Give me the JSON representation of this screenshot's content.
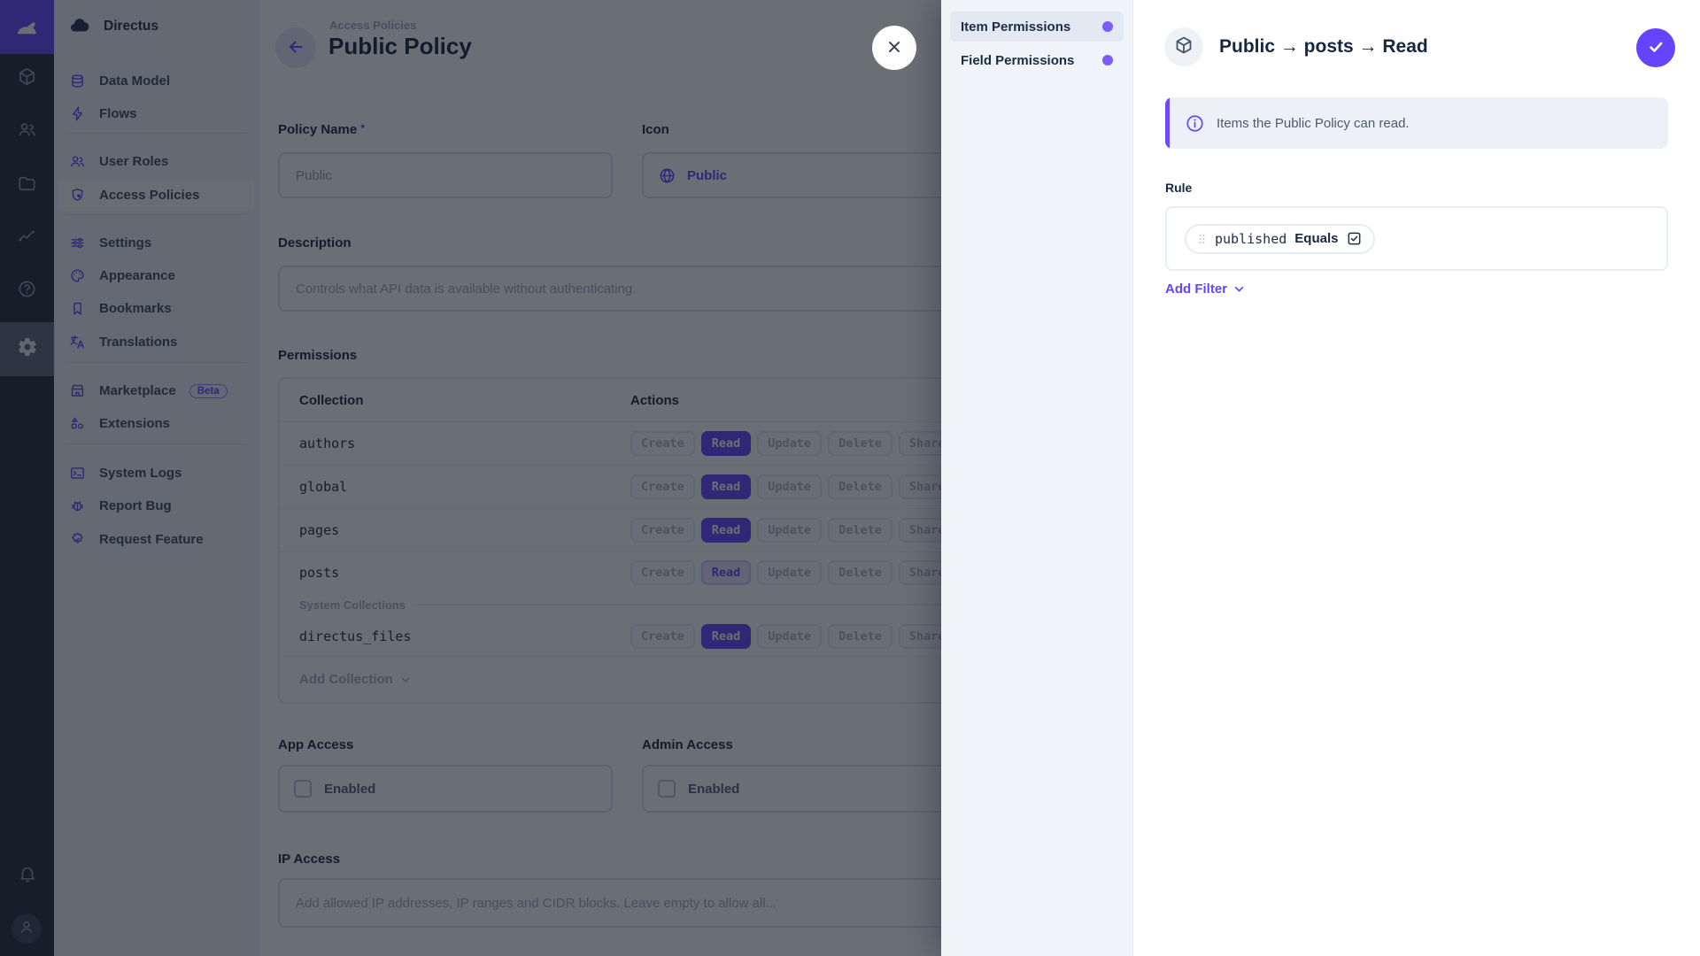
{
  "colors": {
    "purple": "#6644ff",
    "dot_purple": "#7b5cfb",
    "navy": "#172940"
  },
  "icons": {
    "module_bar": [
      "directus-rabbit",
      "box",
      "people",
      "folder",
      "insights",
      "help",
      "gear",
      "bell",
      "person"
    ],
    "nav": [
      "database",
      "bolt",
      "user-roles",
      "shield-lock",
      "sliders",
      "palette",
      "bookmark",
      "translate",
      "storefront",
      "shapes",
      "terminal",
      "bug",
      "badge-check"
    ],
    "misc": [
      "arrow-left",
      "globe",
      "chevron-down",
      "close-x",
      "cube",
      "check",
      "info-circle",
      "drag-handle",
      "checkbox-checked"
    ]
  },
  "nav": {
    "project_name": "Directus",
    "items": [
      {
        "label": "Data Model"
      },
      {
        "label": "Flows"
      },
      {
        "label": "User Roles"
      },
      {
        "label": "Access Policies"
      },
      {
        "label": "Settings"
      },
      {
        "label": "Appearance"
      },
      {
        "label": "Bookmarks"
      },
      {
        "label": "Translations"
      },
      {
        "label": "Marketplace",
        "badge": "Beta"
      },
      {
        "label": "Extensions"
      },
      {
        "label": "System Logs"
      },
      {
        "label": "Report Bug"
      },
      {
        "label": "Request Feature"
      }
    ]
  },
  "main": {
    "breadcrumb": "Access Policies",
    "title": "Public Policy",
    "policy_name": {
      "label": "Policy Name",
      "required_mark": "*",
      "value": "Public"
    },
    "icon_field": {
      "label": "Icon",
      "value": "Public"
    },
    "description": {
      "label": "Description",
      "placeholder": "Controls what API data is available without authenticating."
    },
    "permissions": {
      "label": "Permissions",
      "col_collection": "Collection",
      "col_actions": "Actions",
      "actions": [
        "Create",
        "Read",
        "Update",
        "Delete",
        "Share"
      ],
      "rows": [
        {
          "name": "authors",
          "read_state": "full"
        },
        {
          "name": "global",
          "read_state": "full"
        },
        {
          "name": "pages",
          "read_state": "full"
        },
        {
          "name": "posts",
          "read_state": "custom"
        },
        {
          "name": "directus_files",
          "read_state": "full"
        }
      ],
      "system_divider": "System Collections",
      "add_collection": "Add Collection"
    },
    "app_access": {
      "label": "App Access",
      "checkbox_label": "Enabled"
    },
    "admin_access": {
      "label": "Admin Access",
      "checkbox_label": "Enabled"
    },
    "ip_access": {
      "label": "IP Access",
      "placeholder": "Add allowed IP addresses, IP ranges and CIDR blocks. Leave empty to allow all..."
    }
  },
  "drawer": {
    "tabs": [
      {
        "label": "Item Permissions"
      },
      {
        "label": "Field Permissions"
      }
    ],
    "title": "Public → posts → Read",
    "banner_text": "Items the Public Policy can read.",
    "rule": {
      "label": "Rule",
      "field": "published",
      "operator": "Equals"
    },
    "add_filter_label": "Add Filter"
  }
}
